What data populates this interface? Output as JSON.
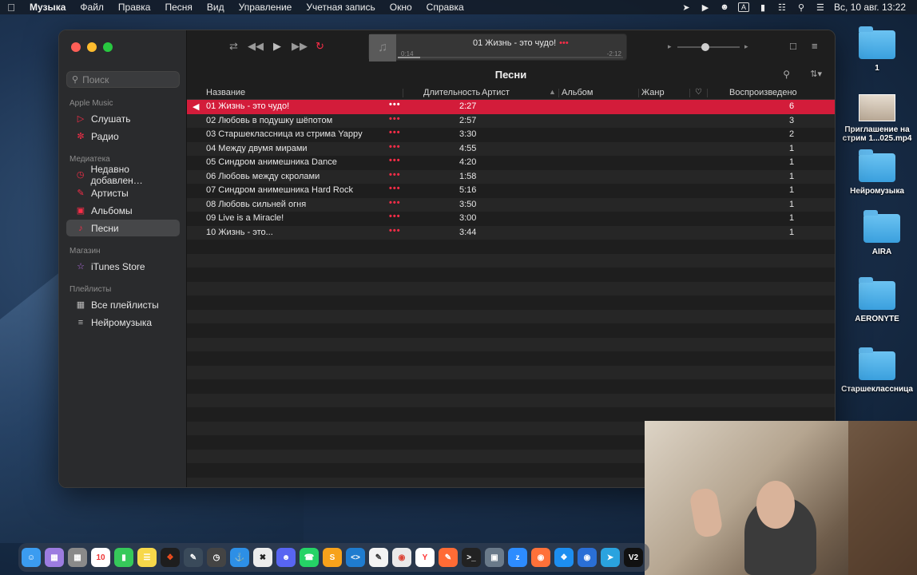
{
  "menubar": {
    "app": "Музыка",
    "items": [
      "Файл",
      "Правка",
      "Песня",
      "Вид",
      "Управление",
      "Учетная запись",
      "Окно",
      "Справка"
    ],
    "keyboard_indicator": "A",
    "datetime": "Вс, 10 авг.  13:22"
  },
  "sidebar": {
    "search_placeholder": "Поиск",
    "sections": {
      "apple_music": "Apple Music",
      "library": "Медиатека",
      "store": "Магазин",
      "playlists": "Плейлисты"
    },
    "items": {
      "listen": "Слушать",
      "radio": "Радио",
      "recent": "Недавно добавлен…",
      "artists": "Артисты",
      "albums": "Альбомы",
      "songs": "Песни",
      "itunes": "iTunes Store",
      "all_playlists": "Все плейлисты",
      "neuromusic": "Нейромузыка"
    }
  },
  "player": {
    "now_playing": "01 Жизнь - это чудо!",
    "elapsed": "0:14",
    "remaining": "-2:12",
    "progress": 0.1,
    "volume": 0.45
  },
  "main": {
    "title": "Песни",
    "columns": {
      "name": "Название",
      "duration": "Длительность",
      "artist": "Артист",
      "album": "Альбом",
      "genre": "Жанр",
      "plays": "Воспроизведено"
    }
  },
  "songs": [
    {
      "name": "01 Жизнь - это чудо!",
      "duration": "2:27",
      "plays": "6"
    },
    {
      "name": "02 Любовь в подушку шёпотом",
      "duration": "2:57",
      "plays": "3"
    },
    {
      "name": "03 Старшеклассница из стрима Yappy",
      "duration": "3:30",
      "plays": "2"
    },
    {
      "name": "04 Между двумя мирами",
      "duration": "4:55",
      "plays": "1"
    },
    {
      "name": "05 Синдром анимешника Dance",
      "duration": "4:20",
      "plays": "1"
    },
    {
      "name": "06 Любовь между скролами",
      "duration": "1:58",
      "plays": "1"
    },
    {
      "name": "07 Синдром анимешника Hard Rock",
      "duration": "5:16",
      "plays": "1"
    },
    {
      "name": "08 Любовь сильней огня",
      "duration": "3:50",
      "plays": "1"
    },
    {
      "name": "09 Live is a Miracle!",
      "duration": "3:00",
      "plays": "1"
    },
    {
      "name": "10 Жизнь - это...",
      "duration": "3:44",
      "plays": "1"
    }
  ],
  "desktop": {
    "folder_1": "1",
    "video": "Приглашение на стрим 1...025.mp4",
    "neuromusic": "Нейромузыка",
    "aira": "AIRA",
    "aeronyte": "AERONYTE",
    "highschool": "Старшеклассница"
  },
  "dock": {
    "calendar_day": "10"
  },
  "colors": {
    "accent": "#fa2d48",
    "playing_row": "#d31c3a"
  }
}
